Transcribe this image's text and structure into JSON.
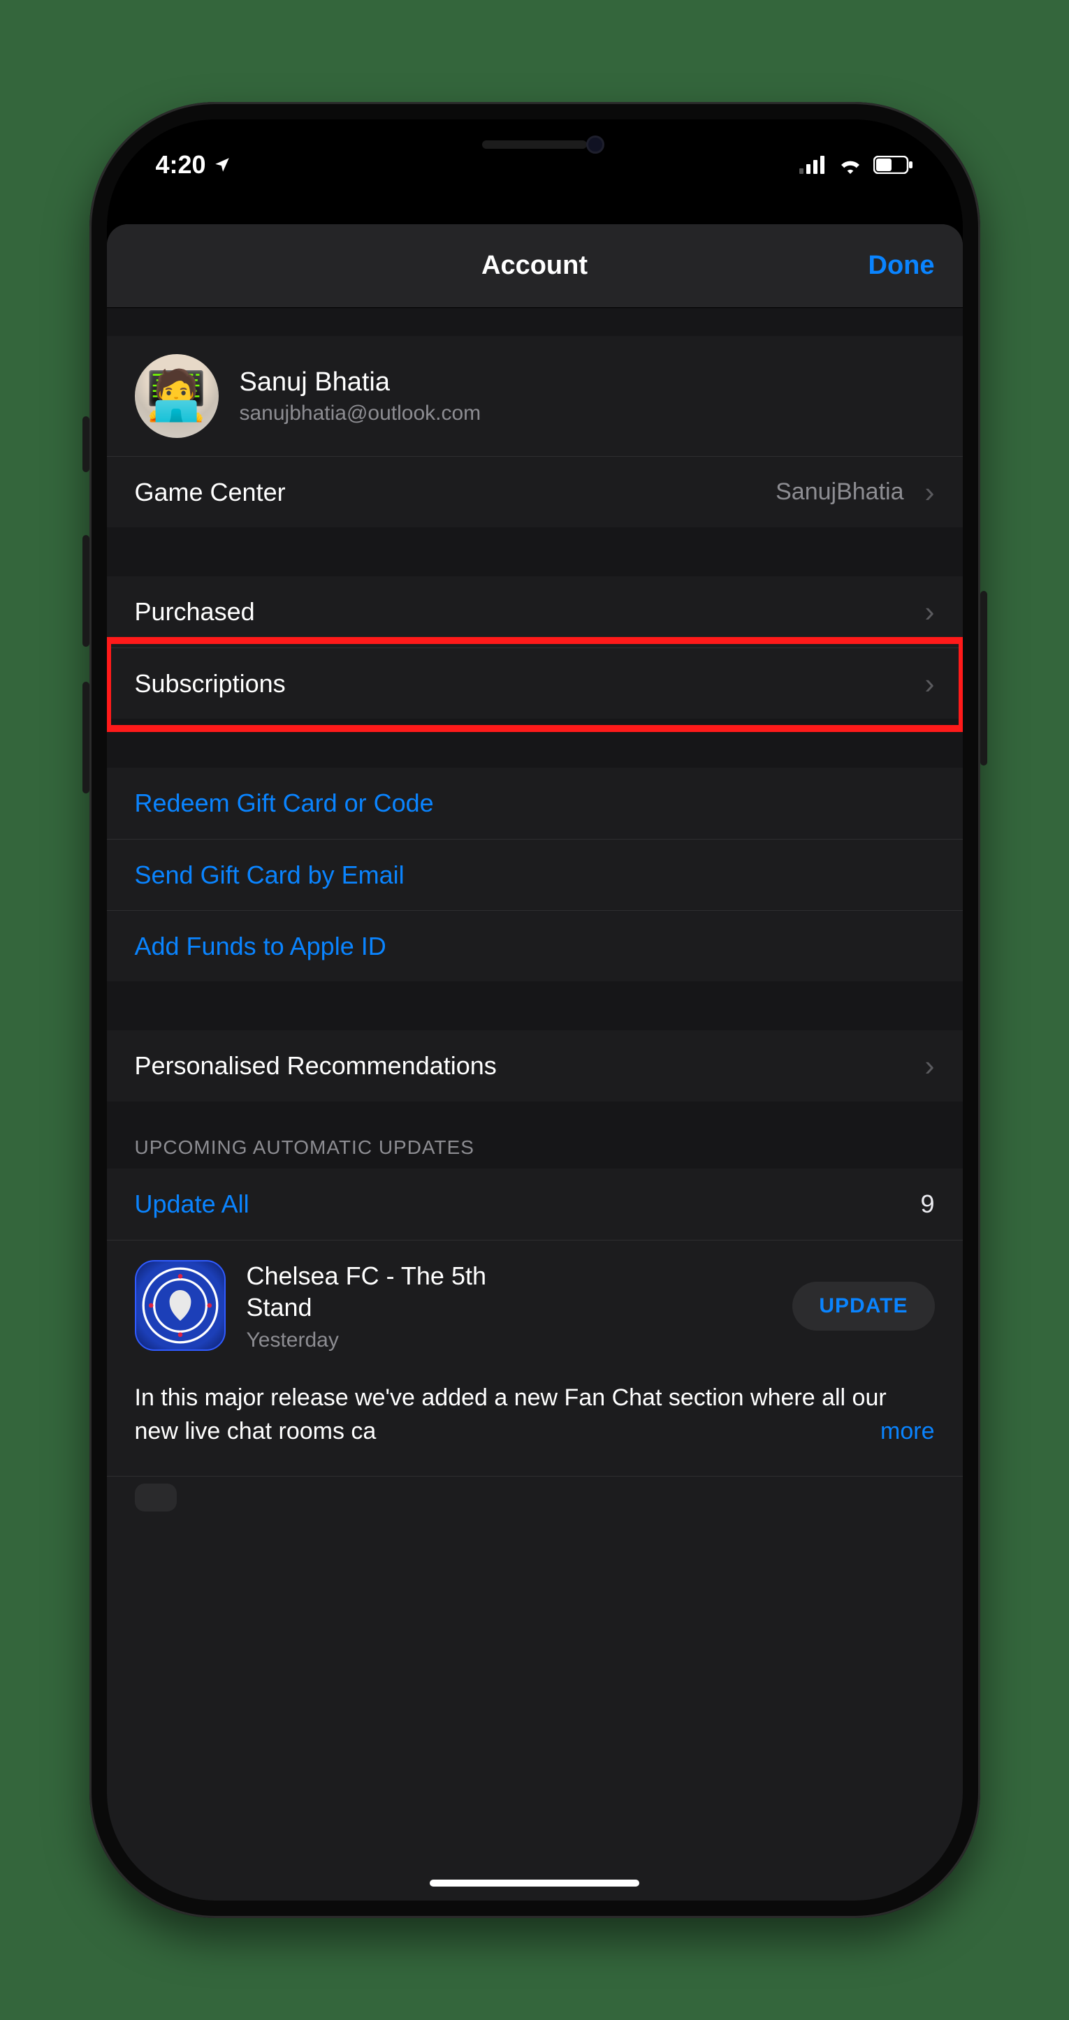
{
  "statusbar": {
    "time": "4:20"
  },
  "nav": {
    "title": "Account",
    "done": "Done"
  },
  "profile": {
    "name": "Sanuj Bhatia",
    "email": "sanujbhatia@outlook.com",
    "avatar_emoji": "🧑‍💻"
  },
  "gamecenter": {
    "label": "Game Center",
    "value": "SanujBhatia"
  },
  "purchases": {
    "purchased": "Purchased",
    "subscriptions": "Subscriptions"
  },
  "gift": {
    "redeem": "Redeem Gift Card or Code",
    "send": "Send Gift Card by Email",
    "addfunds": "Add Funds to Apple ID"
  },
  "recs": {
    "label": "Personalised Recommendations"
  },
  "updates": {
    "header": "UPCOMING AUTOMATIC UPDATES",
    "update_all": "Update All",
    "count": "9",
    "app": {
      "name": "Chelsea FC - The 5th Stand",
      "date": "Yesterday",
      "button": "UPDATE",
      "notes": "In this major release we've added a new Fan Chat section where all our new live chat rooms ca",
      "more": "more"
    }
  }
}
